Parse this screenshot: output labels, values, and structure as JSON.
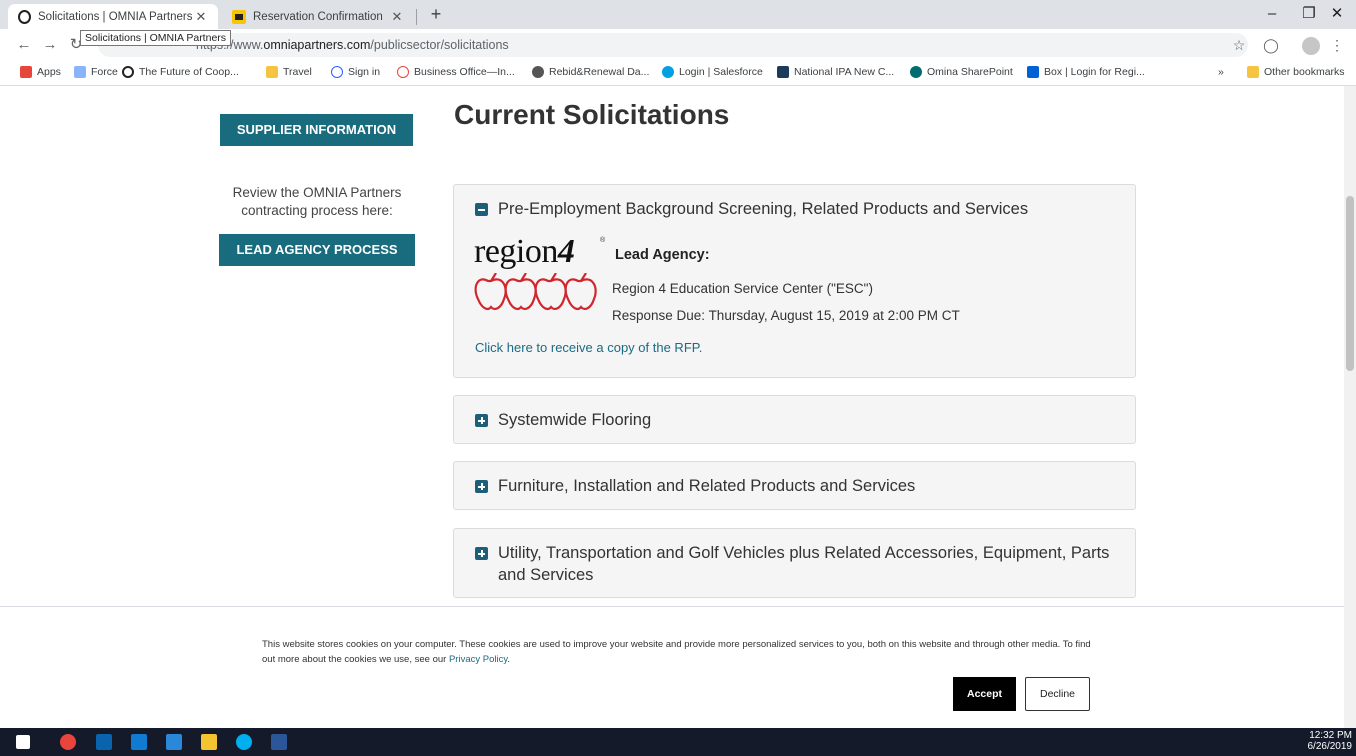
{
  "browser": {
    "tabs": [
      {
        "title": "Solicitations | OMNIA Partners",
        "active": true
      },
      {
        "title": "Reservation Confirmation",
        "active": false
      }
    ],
    "tooltip": "Solicitations | OMNIA Partners",
    "url_domain": "omniapartners.com",
    "url_path": "/publicsector/solicitations",
    "url_prefix": "https://www.",
    "bookmarks": [
      {
        "label": "Apps",
        "color": "#e8453c"
      },
      {
        "label": "Force",
        "color": "#8ab4f8"
      },
      {
        "label": "The Future of Coop...",
        "color": "#222222"
      },
      {
        "label": "Travel",
        "color": "#f5c542"
      },
      {
        "label": "Sign in",
        "color": "#2962ff"
      },
      {
        "label": "Business Office—In...",
        "color": "#e8453c"
      },
      {
        "label": "Rebid&Renewal Da...",
        "color": "#555555"
      },
      {
        "label": "Login | Salesforce",
        "color": "#00a1e0"
      },
      {
        "label": "National IPA New C...",
        "color": "#1b3a5c"
      },
      {
        "label": "Omina SharePoint",
        "color": "#036c70"
      },
      {
        "label": "Box | Login for Regi...",
        "color": "#0061d5"
      }
    ],
    "bookmarks_overflow": "»",
    "other_bookmarks": "Other bookmarks"
  },
  "sidebar": {
    "supplier_button": "SUPPLIER INFORMATION",
    "review_text": "Review the OMNIA Partners contracting process here:",
    "lead_agency_button": "LEAD AGENCY PROCESS"
  },
  "main": {
    "title": "Current Solicitations",
    "solicitations": [
      {
        "title": "Pre-Employment Background Screening, Related Products and Services",
        "expanded": true,
        "logo_text": "region",
        "logo_number": "4",
        "logo_reg": "®",
        "lead_agency_label": "Lead Agency:",
        "lead_agency": "Region 4 Education Service Center (\"ESC\")",
        "response_due": "Response Due:  Thursday, August 15, 2019 at 2:00 PM CT",
        "rfp_link": "Click here to receive a copy of the RFP."
      },
      {
        "title": "Systemwide Flooring",
        "expanded": false
      },
      {
        "title": "Furniture, Installation and Related Products and Services",
        "expanded": false
      },
      {
        "title": "Utility, Transportation and Golf Vehicles plus Related Accessories, Equipment, Parts and Services",
        "expanded": false
      }
    ]
  },
  "cookie_banner": {
    "text": "This website stores cookies on your computer. These cookies are used to improve your website and provide more personalized services to you, both on this website and through other media. To find out more about the cookies we use, see our",
    "link": "Privacy Policy",
    "link_suffix": ".",
    "accept": "Accept",
    "decline": "Decline"
  },
  "taskbar": {
    "time": "12:32 PM",
    "date": "6/26/2019"
  },
  "colors": {
    "teal": "#186c7e",
    "toggle": "#1d5f78",
    "link": "#1a6b84",
    "apple_red": "#d0272e"
  }
}
